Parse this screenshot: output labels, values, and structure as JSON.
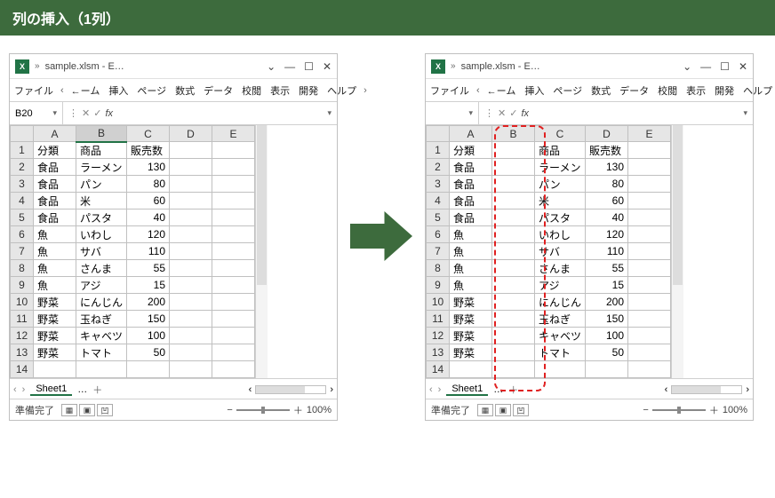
{
  "header": "列の挿入（1列）",
  "window_title": "sample.xlsm  -  E…",
  "tabs": [
    "ファイル",
    "ホーム",
    "挿入",
    "ページ",
    "数式",
    "データ",
    "校閲",
    "表示",
    "開発",
    "ヘルプ"
  ],
  "tabs_shown": {
    "t0": "ファイル",
    "t1": "←ーム",
    "t2": "挿入",
    "t3": "ページ",
    "t4": "数式",
    "t5": "データ",
    "t6": "校閲",
    "t7": "表示",
    "t8": "開発",
    "t9": "ヘルプ"
  },
  "namebox_left": "B20",
  "namebox_right": "",
  "fx_label": "fx",
  "col_headers_left": [
    "A",
    "B",
    "C",
    "D",
    "E"
  ],
  "col_headers_right": [
    "A",
    "B",
    "C",
    "D",
    "E"
  ],
  "rows_left": [
    {
      "r": "1",
      "a": "分類",
      "b": "商品",
      "c": "販売数",
      "d": "",
      "e": ""
    },
    {
      "r": "2",
      "a": "食品",
      "b": "ラーメン",
      "c": "130",
      "d": "",
      "e": ""
    },
    {
      "r": "3",
      "a": "食品",
      "b": "パン",
      "c": "80",
      "d": "",
      "e": ""
    },
    {
      "r": "4",
      "a": "食品",
      "b": "米",
      "c": "60",
      "d": "",
      "e": ""
    },
    {
      "r": "5",
      "a": "食品",
      "b": "パスタ",
      "c": "40",
      "d": "",
      "e": ""
    },
    {
      "r": "6",
      "a": "魚",
      "b": "いわし",
      "c": "120",
      "d": "",
      "e": ""
    },
    {
      "r": "7",
      "a": "魚",
      "b": "サバ",
      "c": "110",
      "d": "",
      "e": ""
    },
    {
      "r": "8",
      "a": "魚",
      "b": "さんま",
      "c": "55",
      "d": "",
      "e": ""
    },
    {
      "r": "9",
      "a": "魚",
      "b": "アジ",
      "c": "15",
      "d": "",
      "e": ""
    },
    {
      "r": "10",
      "a": "野菜",
      "b": "にんじん",
      "c": "200",
      "d": "",
      "e": ""
    },
    {
      "r": "11",
      "a": "野菜",
      "b": "玉ねぎ",
      "c": "150",
      "d": "",
      "e": ""
    },
    {
      "r": "12",
      "a": "野菜",
      "b": "キャベツ",
      "c": "100",
      "d": "",
      "e": ""
    },
    {
      "r": "13",
      "a": "野菜",
      "b": "トマト",
      "c": "50",
      "d": "",
      "e": ""
    },
    {
      "r": "14",
      "a": "",
      "b": "",
      "c": "",
      "d": "",
      "e": ""
    }
  ],
  "rows_right": [
    {
      "r": "1",
      "a": "分類",
      "b": "",
      "c": "商品",
      "d": "販売数",
      "e": ""
    },
    {
      "r": "2",
      "a": "食品",
      "b": "",
      "c": "ラーメン",
      "d": "130",
      "e": ""
    },
    {
      "r": "3",
      "a": "食品",
      "b": "",
      "c": "パン",
      "d": "80",
      "e": ""
    },
    {
      "r": "4",
      "a": "食品",
      "b": "",
      "c": "米",
      "d": "60",
      "e": ""
    },
    {
      "r": "5",
      "a": "食品",
      "b": "",
      "c": "パスタ",
      "d": "40",
      "e": ""
    },
    {
      "r": "6",
      "a": "魚",
      "b": "",
      "c": "いわし",
      "d": "120",
      "e": ""
    },
    {
      "r": "7",
      "a": "魚",
      "b": "",
      "c": "サバ",
      "d": "110",
      "e": ""
    },
    {
      "r": "8",
      "a": "魚",
      "b": "",
      "c": "さんま",
      "d": "55",
      "e": ""
    },
    {
      "r": "9",
      "a": "魚",
      "b": "",
      "c": "アジ",
      "d": "15",
      "e": ""
    },
    {
      "r": "10",
      "a": "野菜",
      "b": "",
      "c": "にんじん",
      "d": "200",
      "e": ""
    },
    {
      "r": "11",
      "a": "野菜",
      "b": "",
      "c": "玉ねぎ",
      "d": "150",
      "e": ""
    },
    {
      "r": "12",
      "a": "野菜",
      "b": "",
      "c": "キャベツ",
      "d": "100",
      "e": ""
    },
    {
      "r": "13",
      "a": "野菜",
      "b": "",
      "c": "トマト",
      "d": "50",
      "e": ""
    },
    {
      "r": "14",
      "a": "",
      "b": "",
      "c": "",
      "d": "",
      "e": ""
    }
  ],
  "sheet_name": "Sheet1",
  "status_text": "準備完了",
  "zoom_text": "100%",
  "ellipsis": "…",
  "plus": "＋",
  "minus": "−",
  "chev_right": "»",
  "chev_l": "‹",
  "chev_r": "›",
  "win_ctrl": {
    "min": "—",
    "max": "☐",
    "close": "✕",
    "down": "⌄"
  }
}
